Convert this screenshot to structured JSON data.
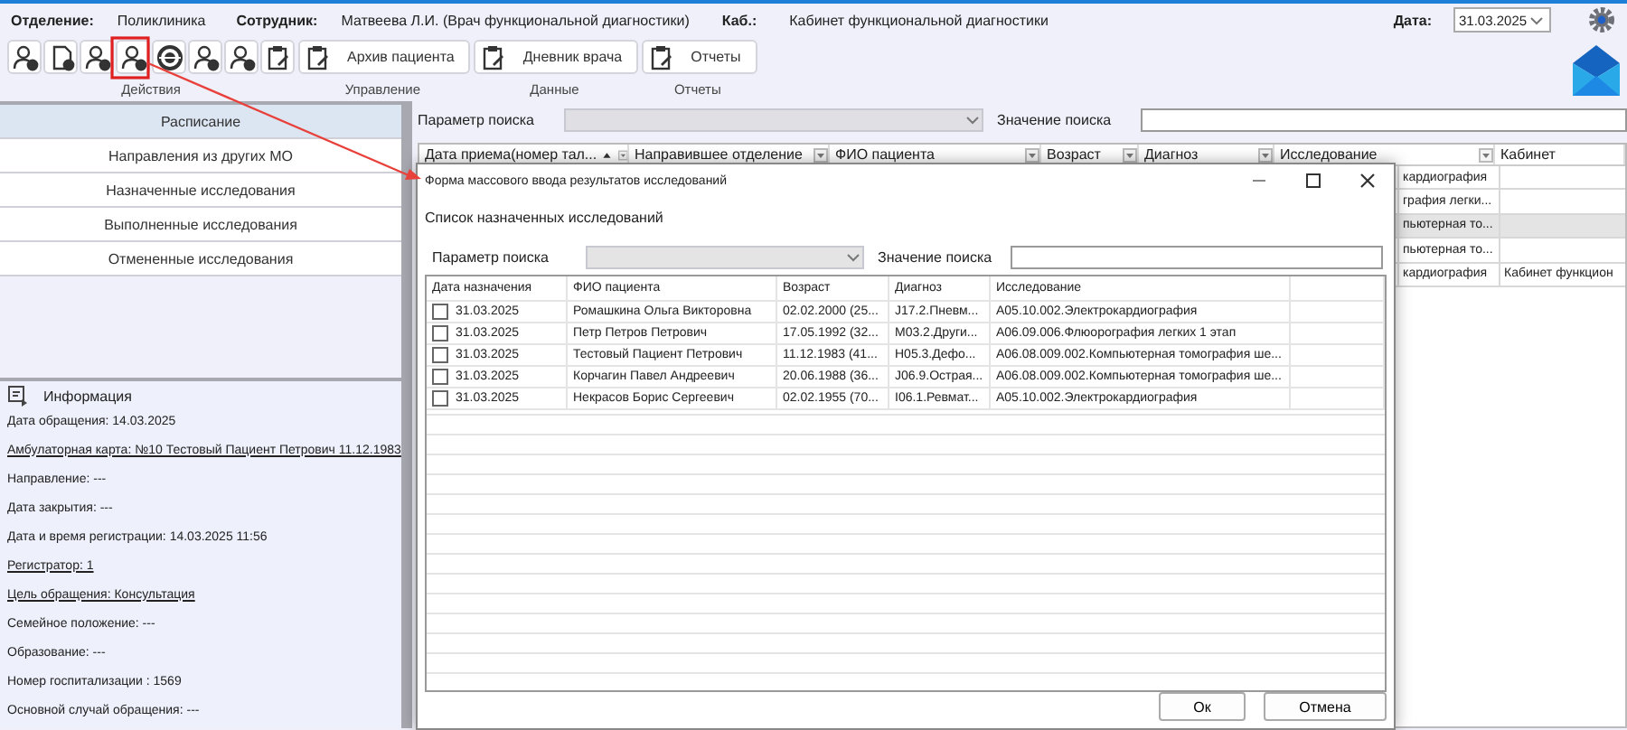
{
  "header": {
    "department_label": "Отделение:",
    "department": "Поликлиника",
    "employee_label": "Сотрудник:",
    "employee": "Матвеева Л.И. (Врач функциональной диагностики)",
    "room_label": "Каб.:",
    "room": "Кабинет функциональной диагностики",
    "date_label": "Дата:",
    "date": "31.03.2025"
  },
  "toolbar": {
    "groups": [
      {
        "label": "Действия"
      },
      {
        "label": "Управление",
        "buttons": [
          "Архив пациента"
        ]
      },
      {
        "label": "Данные",
        "buttons": [
          "Дневник врача"
        ]
      },
      {
        "label": "Отчеты",
        "buttons": [
          "Отчеты"
        ]
      }
    ]
  },
  "nav": [
    {
      "label": "Расписание",
      "selected": true
    },
    {
      "label": "Направления из других МО",
      "selected": false
    },
    {
      "label": "Назначенные исследования",
      "selected": false
    },
    {
      "label": "Выполненные исследования",
      "selected": false
    },
    {
      "label": "Отмененные исследования",
      "selected": false
    }
  ],
  "info": {
    "title": "Информация",
    "lines": [
      {
        "text": "Дата обращения: 14.03.2025",
        "link": false
      },
      {
        "text": "Амбулаторная карта: №10 Тестовый Пациент Петрович 11.12.1983",
        "link": true
      },
      {
        "text": "Направление: ---",
        "link": false
      },
      {
        "text": "Дата закрытия: ---",
        "link": false
      },
      {
        "text": "Дата и время регистрации: 14.03.2025 11:56",
        "link": false
      },
      {
        "text": "Регистратор: 1",
        "link": true
      },
      {
        "text": "Цель обращения: Консультация",
        "link": true
      },
      {
        "text": "Семейное положение: ---",
        "link": false
      },
      {
        "text": "Образование: ---",
        "link": false
      },
      {
        "text": "Номер госпитализации : 1569",
        "link": false
      },
      {
        "text": "Основной случай обращения: ---",
        "link": false
      }
    ]
  },
  "search": {
    "param_label": "Параметр поиска",
    "value_label": "Значение поиска"
  },
  "table": {
    "columns": [
      "Дата приема(номер тал...",
      "Направившее отделение",
      "ФИО пациента",
      "Возраст",
      "Диагноз",
      "Исследование",
      "Кабинет"
    ],
    "rows": [
      {
        "research": "кардиография",
        "cabinet": "",
        "selected": false
      },
      {
        "research": "графия легки...",
        "cabinet": "",
        "selected": false
      },
      {
        "research": "пьютерная то...",
        "cabinet": "",
        "selected": true
      },
      {
        "research": "пьютерная то...",
        "cabinet": "",
        "selected": false
      },
      {
        "research": "кардиография",
        "cabinet": "Кабинет функцион",
        "selected": false
      }
    ]
  },
  "dialog": {
    "title": "Форма массового ввода результатов исследований",
    "subtitle": "Список назначенных исследований",
    "param_label": "Параметр поиска",
    "value_label": "Значение поиска",
    "columns": [
      "Дата назначения",
      "ФИО пациента",
      "Возраст",
      "Диагноз",
      "Исследование"
    ],
    "rows": [
      {
        "checked": false,
        "date": "31.03.2025",
        "name": "Ромашкина Ольга Викторовна",
        "age": "02.02.2000 (25...",
        "diagnosis": "J17.2.Пневм...",
        "research": "A05.10.002.Электрокардиография"
      },
      {
        "checked": false,
        "date": "31.03.2025",
        "name": "Петр Петров Петрович",
        "age": "17.05.1992 (32...",
        "diagnosis": "M03.2.Други...",
        "research": "A06.09.006.Флюорография легких 1 этап"
      },
      {
        "checked": false,
        "date": "31.03.2025",
        "name": "Тестовый Пациент Петрович",
        "age": "11.12.1983 (41...",
        "diagnosis": "H05.3.Дефо...",
        "research": "A06.08.009.002.Компьютерная томография ше..."
      },
      {
        "checked": false,
        "date": "31.03.2025",
        "name": "Корчагин Павел Андреевич",
        "age": "20.06.1988 (36...",
        "diagnosis": "J06.9.Острая...",
        "research": "A06.08.009.002.Компьютерная томография ше..."
      },
      {
        "checked": false,
        "date": "31.03.2025",
        "name": "Некрасов Борис Сергеевич",
        "age": "02.02.1955 (70...",
        "diagnosis": "I06.1.Ревмат...",
        "research": "A05.10.002.Электрокардиография"
      }
    ],
    "buttons": [
      "Ок",
      "Отмена"
    ]
  }
}
